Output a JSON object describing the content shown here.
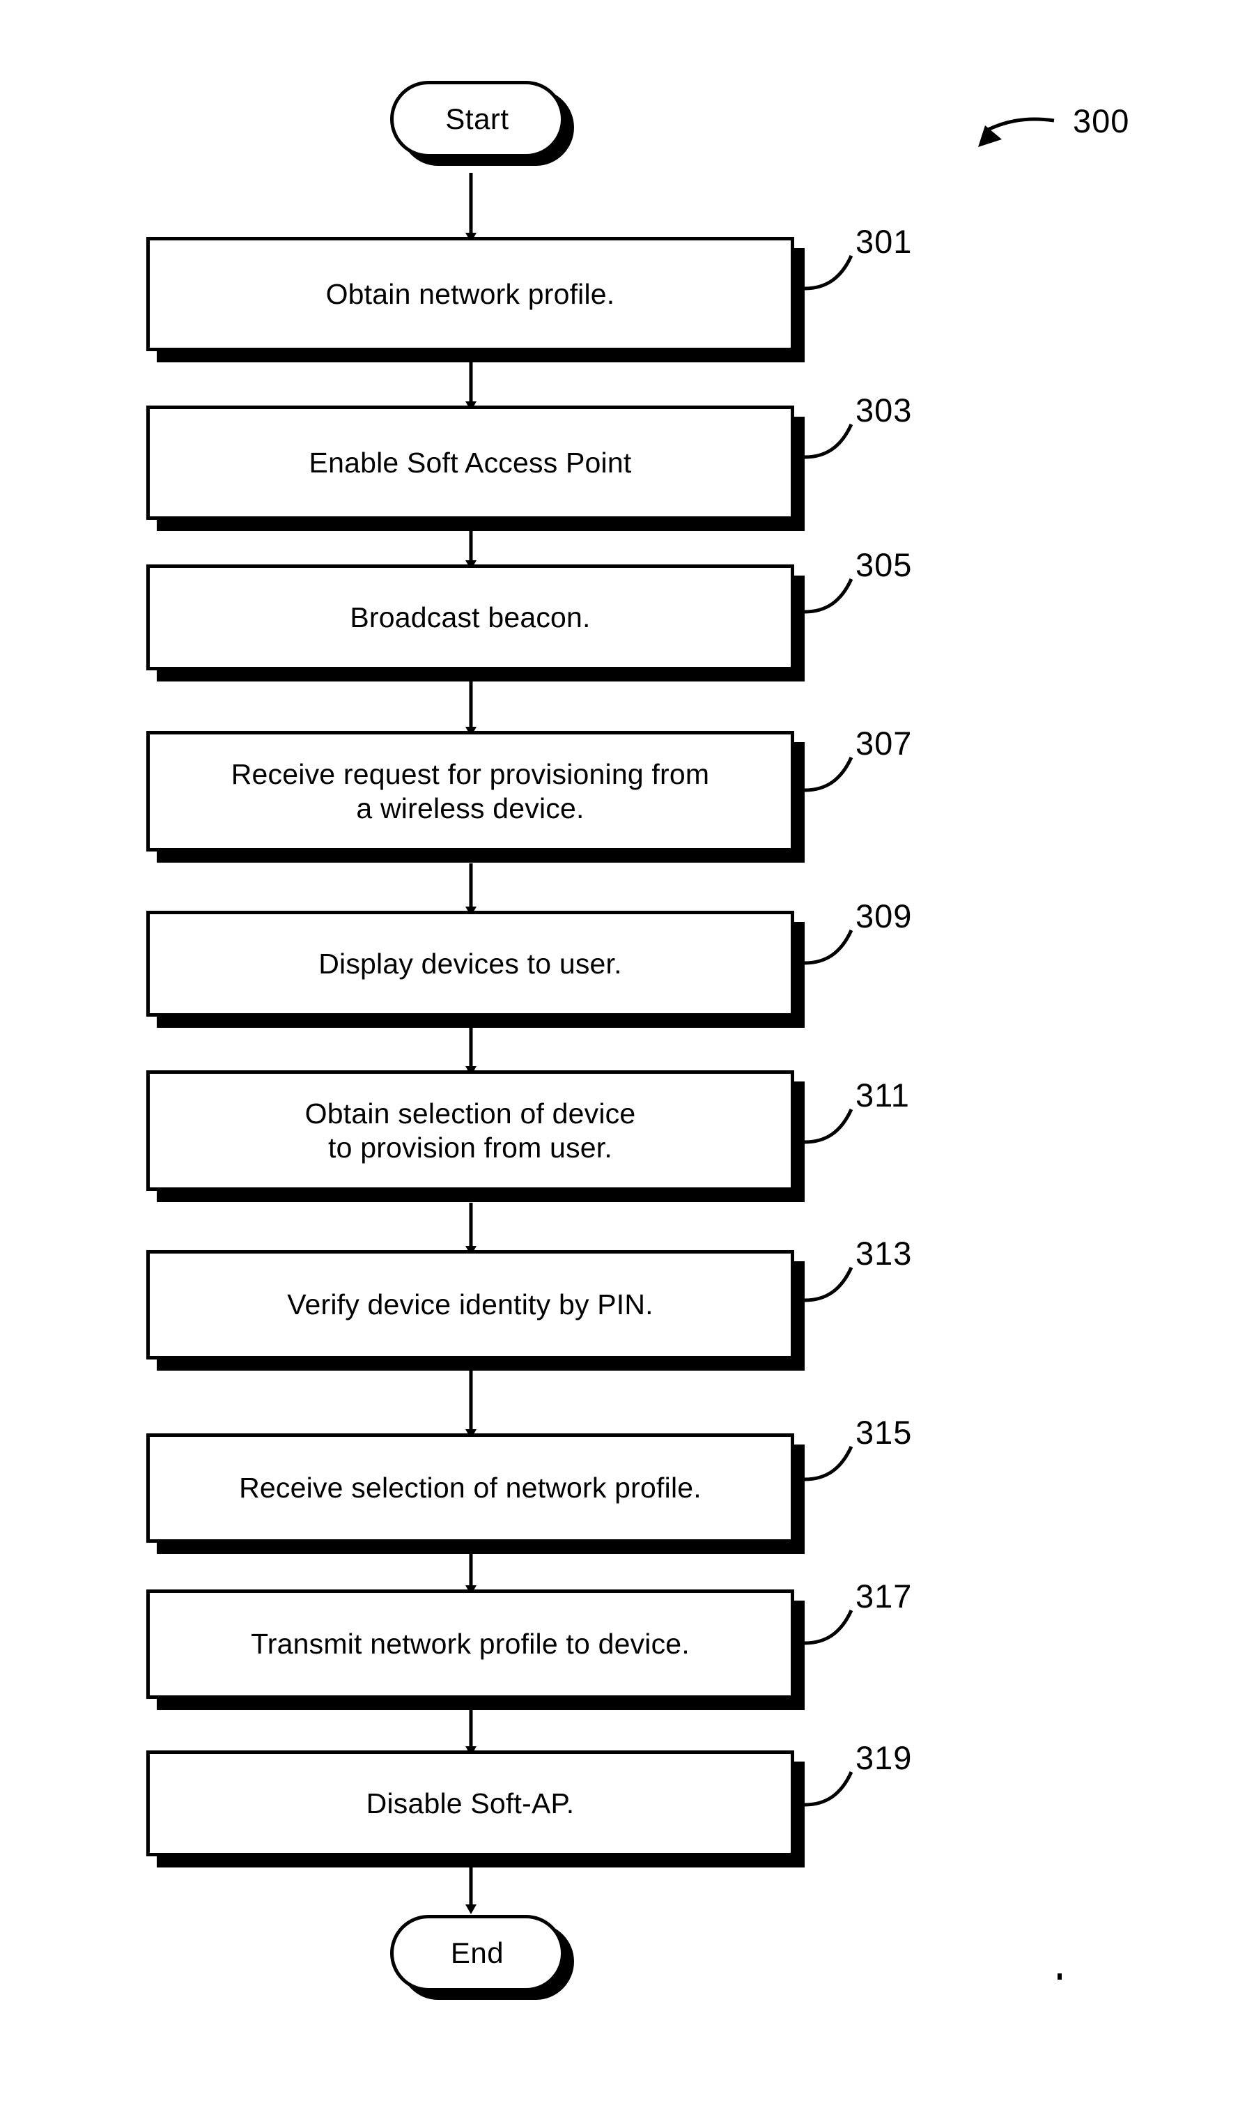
{
  "figure": {
    "number": "300",
    "type": "flowchart"
  },
  "nodes": {
    "start": {
      "label": "Start"
    },
    "end": {
      "label": "End"
    }
  },
  "steps": [
    {
      "ref": "301",
      "text": "Obtain network profile."
    },
    {
      "ref": "303",
      "text": "Enable Soft Access Point"
    },
    {
      "ref": "305",
      "text": "Broadcast beacon."
    },
    {
      "ref": "307",
      "text": "Receive request for provisioning from\na wireless device."
    },
    {
      "ref": "309",
      "text": "Display devices to user."
    },
    {
      "ref": "311",
      "text": "Obtain selection of device\nto provision from user."
    },
    {
      "ref": "313",
      "text": "Verify device identity by PIN."
    },
    {
      "ref": "315",
      "text": "Receive selection of network profile."
    },
    {
      "ref": "317",
      "text": "Transmit network profile to device."
    },
    {
      "ref": "319",
      "text": "Disable Soft-AP."
    }
  ],
  "colors": {
    "stroke": "#000000",
    "fill": "#ffffff",
    "shadow": "#000000"
  }
}
